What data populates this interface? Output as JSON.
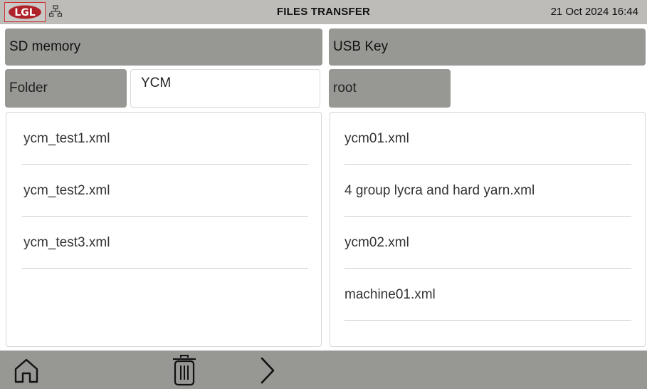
{
  "header": {
    "title": "FILES TRANSFER",
    "datetime": "21 Oct 2024 16:44",
    "logo_text": "LGL",
    "network_icon": "network-icon"
  },
  "left": {
    "label": "SD memory",
    "folder_label": "Folder",
    "folder_value": "YCM",
    "files": [
      "ycm_test1.xml",
      "ycm_test2.xml",
      "ycm_test3.xml"
    ]
  },
  "right": {
    "label": "USB Key",
    "folder": "root",
    "files": [
      "ycm01.xml",
      "4 group lycra and hard yarn.xml",
      "ycm02.xml",
      "machine01.xml"
    ]
  },
  "footer": {
    "home_icon": "home-icon",
    "delete_icon": "trash-icon",
    "next_icon": "chevron-right-icon"
  },
  "colors": {
    "topbar": "#bdbcb8",
    "panel_header": "#979894",
    "bottombar": "#979894"
  }
}
